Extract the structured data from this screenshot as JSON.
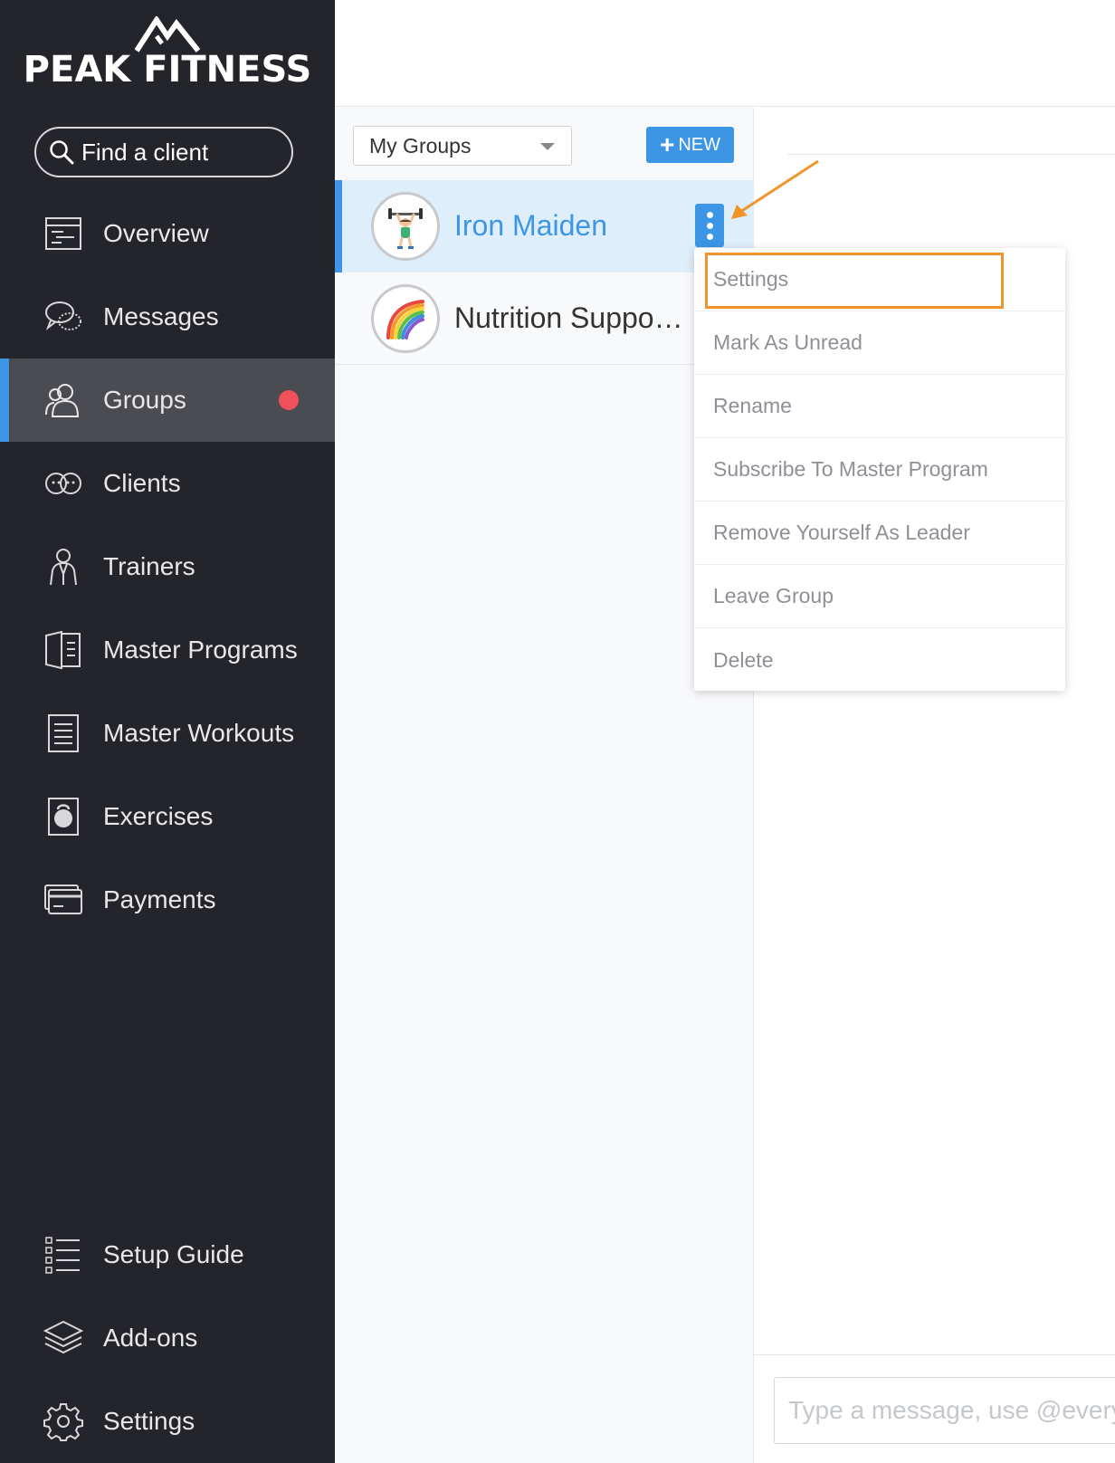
{
  "sidebar": {
    "brand": "PEAK FITNESS",
    "search_placeholder": "Find a client",
    "items": [
      {
        "label": "Overview",
        "icon": "overview-icon"
      },
      {
        "label": "Messages",
        "icon": "messages-icon"
      },
      {
        "label": "Groups",
        "icon": "groups-icon",
        "active": true,
        "has_badge": true
      },
      {
        "label": "Clients",
        "icon": "clients-icon"
      },
      {
        "label": "Trainers",
        "icon": "trainer-icon"
      },
      {
        "label": "Master Programs",
        "icon": "master-programs-icon"
      },
      {
        "label": "Master Workouts",
        "icon": "master-workouts-icon"
      },
      {
        "label": "Exercises",
        "icon": "kettlebell-icon"
      },
      {
        "label": "Payments",
        "icon": "payments-icon"
      }
    ],
    "bottom_items": [
      {
        "label": "Setup Guide",
        "icon": "checklist-icon"
      },
      {
        "label": "Add-ons",
        "icon": "layers-icon"
      },
      {
        "label": "Settings",
        "icon": "gear-icon"
      }
    ]
  },
  "groups_panel": {
    "filter_selected": "My Groups",
    "new_button": "NEW",
    "groups": [
      {
        "name": "Iron Maiden",
        "avatar": "weightlifter-emoji",
        "active": true
      },
      {
        "name": "Nutrition Support Group",
        "avatar": "rainbow-emoji",
        "active": false
      }
    ]
  },
  "context_menu": {
    "items": [
      "Settings",
      "Mark As Unread",
      "Rename",
      "Subscribe To Master Program",
      "Remove Yourself As Leader",
      "Leave Group",
      "Delete"
    ],
    "highlighted": "Settings"
  },
  "composer": {
    "placeholder": "Type a message, use @everyone to notify all"
  },
  "colors": {
    "sidebar_bg": "#24252a",
    "accent_blue": "#3d95e6",
    "badge_red": "#f0505a",
    "highlight_orange": "#f0942a"
  }
}
